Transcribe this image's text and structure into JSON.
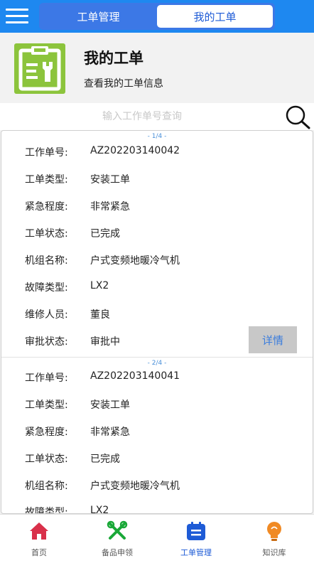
{
  "topbar": {
    "tabs": [
      {
        "label": "工单管理",
        "active": false
      },
      {
        "label": "我的工单",
        "active": true
      }
    ]
  },
  "header": {
    "icon": "clipboard-wrench-icon",
    "title": "我的工单",
    "subtitle": "查看我的工单信息"
  },
  "search": {
    "placeholder": "输入工作单号查询",
    "icon": "search-icon"
  },
  "orders": [
    {
      "index": "- 1/4 -",
      "fields": [
        {
          "label": "工作单号:",
          "value": "AZ202203140042"
        },
        {
          "label": "工单类型:",
          "value": "安装工单"
        },
        {
          "label": "紧急程度:",
          "value": "非常紧急"
        },
        {
          "label": "工单状态:",
          "value": "已完成"
        },
        {
          "label": "机组名称:",
          "value": "户式变频地暖冷气机"
        },
        {
          "label": "故障类型:",
          "value": "LX2"
        },
        {
          "label": "维修人员:",
          "value": "董良"
        },
        {
          "label": "审批状态:",
          "value": "审批中"
        }
      ],
      "detail_label": "详情"
    },
    {
      "index": "- 2/4 -",
      "fields": [
        {
          "label": "工作单号:",
          "value": "AZ202203140041"
        },
        {
          "label": "工单类型:",
          "value": "安装工单"
        },
        {
          "label": "紧急程度:",
          "value": "非常紧急"
        },
        {
          "label": "工单状态:",
          "value": "已完成"
        },
        {
          "label": "机组名称:",
          "value": "户式变频地暖冷气机"
        },
        {
          "label": "故障类型:",
          "value": "LX2"
        }
      ]
    }
  ],
  "tabbar": {
    "items": [
      {
        "label": "首页",
        "icon": "home-icon"
      },
      {
        "label": "备品申领",
        "icon": "tools-icon"
      },
      {
        "label": "工单管理",
        "icon": "calendar-icon",
        "active": true
      },
      {
        "label": "知识库",
        "icon": "lightbulb-icon"
      }
    ]
  },
  "colors": {
    "primary": "#1e88f0",
    "accent": "#1e5bd6",
    "header_icon": "#8cc43c",
    "home_icon": "#d9304a",
    "tools_icon": "#1aa838",
    "bulb_icon": "#f08a24"
  }
}
